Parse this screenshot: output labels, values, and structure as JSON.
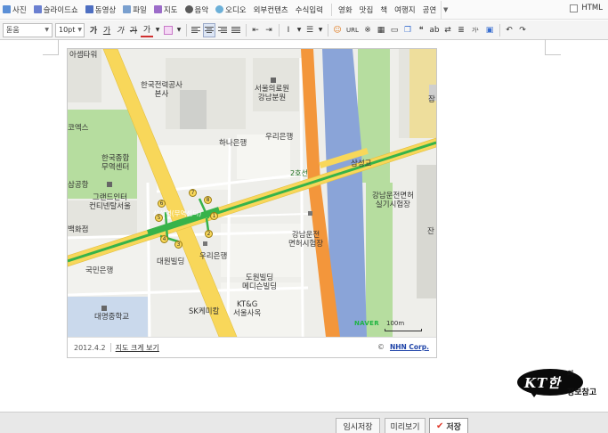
{
  "toolbar": {
    "insert_items": [
      {
        "label": "사진",
        "icon": "photo-icon",
        "color": "#5b8fd6"
      },
      {
        "label": "슬라이드쇼",
        "icon": "slideshow-icon",
        "color": "#6a7fd0"
      },
      {
        "label": "동영상",
        "icon": "video-icon",
        "color": "#4e6fc2"
      },
      {
        "label": "파일",
        "icon": "file-icon",
        "color": "#7aa0cf"
      },
      {
        "label": "지도",
        "icon": "map-icon",
        "color": "#9c6cc9"
      },
      {
        "label": "음악",
        "icon": "music-icon",
        "color": "#5a5a5a"
      },
      {
        "label": "오디오",
        "icon": "audio-icon",
        "color": "#6cb0d8"
      },
      {
        "label": "외부컨텐츠",
        "icon": "",
        "color": ""
      },
      {
        "label": "수식입력",
        "icon": "",
        "color": ""
      }
    ],
    "category_items": [
      "영화",
      "맛집",
      "책",
      "여행지",
      "공연"
    ],
    "html_label": "HTML",
    "font_family": "돋움",
    "font_size": "10pt"
  },
  "map": {
    "labels": {
      "top_left": "아셈타워",
      "kepco": "한국전력공사\n본사",
      "seoul_hospital": "서울의료원\n강남분원",
      "hana": "하나은행",
      "woori1": "우리은행",
      "coex": "코엑스",
      "kita": "한국종합\n무역센터",
      "road_2": "2호선",
      "samseong_bridge": "삼성교",
      "license_right": "강남운전면허\n실기시험장",
      "gongwon": "삼공항",
      "intercontinental": "그랜드인터\n컨티넨탈서울",
      "station": "삼성역(무역센터)",
      "dept": "백화점",
      "license_center": "강남운전\n면허시험장",
      "woori2": "우리은행",
      "kookmin": "국민은행",
      "daewon": "대원빌딩",
      "doowon": "도원빌딩\n메디슨빌딩",
      "kt": "KT&G\n서울사옥",
      "sk": "SK케미칼",
      "daemyung": "대명중학교",
      "right_edge": "잠",
      "right_edge2": "잔"
    },
    "exits": [
      "1",
      "2",
      "3",
      "4",
      "5",
      "6",
      "7",
      "8"
    ],
    "naver_logo": "NAVER",
    "scale_label": "100m",
    "date": "2012.4.2",
    "view_larger": "지도 크게 보기",
    "copyright_symbol": "©",
    "copyright_company": "NHN Corp.",
    "colors": {
      "expressway": "#f3963b",
      "arterial": "#f8d75a",
      "river": "#8aa4d8",
      "park": "#b6dd9f",
      "subway_line": "#37b34a"
    }
  },
  "watermark": {
    "main": "KT한",
    "small_top": "의",
    "small_bottom": "정보참고"
  },
  "bottom_bar": {
    "temp_save": "임시저장",
    "preview": "미리보기",
    "save": "저장"
  }
}
